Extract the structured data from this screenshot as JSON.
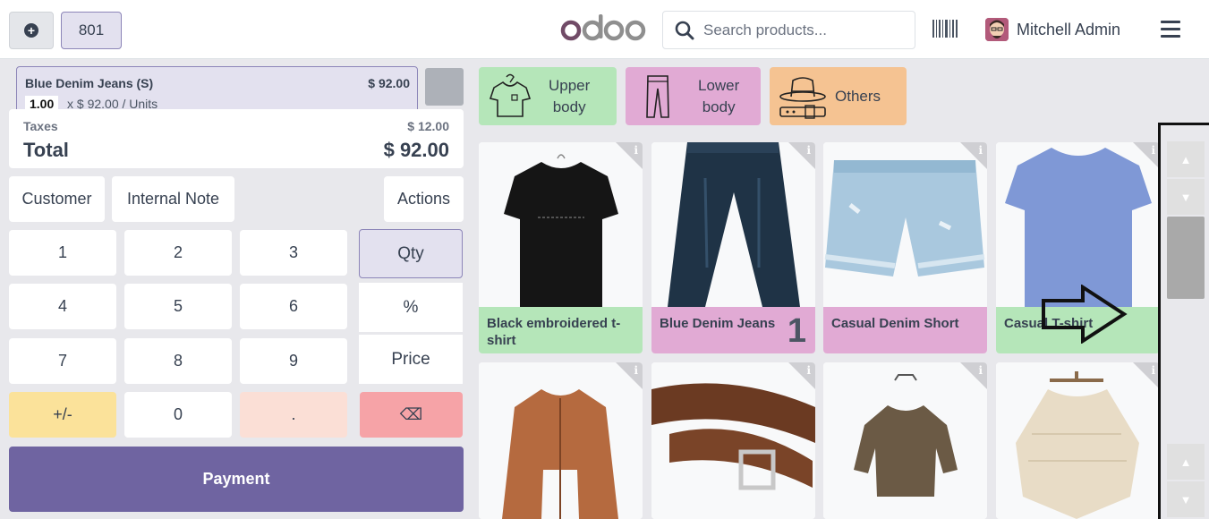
{
  "topbar": {
    "order_number": "801",
    "logo_text": "odoo",
    "search_placeholder": "Search products...",
    "user_name": "Mitchell Admin"
  },
  "order": {
    "line_name": "Blue Denim Jeans (S)",
    "line_price": "$ 92.00",
    "line_qty": "1.00",
    "line_unit": "x $ 92.00 / Units",
    "taxes_label": "Taxes",
    "taxes_value": "$ 12.00",
    "total_label": "Total",
    "total_value": "$ 92.00"
  },
  "control_buttons": {
    "customer": "Customer",
    "internal_note": "Internal Note",
    "actions": "Actions"
  },
  "numpad": {
    "keys": [
      "1",
      "2",
      "3",
      "4",
      "5",
      "6",
      "7",
      "8",
      "9",
      "+/-",
      "0",
      "."
    ],
    "backspace": "⌫",
    "modes": [
      "Qty",
      "%",
      "Price"
    ],
    "active_mode": "Qty"
  },
  "payment_label": "Payment",
  "categories": [
    {
      "line1": "Upper",
      "line2": "body",
      "color": "#b5e6b9",
      "icon": "shirt-icon"
    },
    {
      "line1": "Lower",
      "line2": "body",
      "color": "#e1aad4",
      "icon": "pants-icon"
    },
    {
      "line1": "Others",
      "line2": "",
      "color": "#f5c392",
      "icon": "hat-belt-icon"
    }
  ],
  "products": [
    {
      "name": "Black embroidered t-shirt",
      "color": "#b5e6b9",
      "badge": ""
    },
    {
      "name": "Blue Denim Jeans",
      "color": "#e1aad4",
      "badge": "1"
    },
    {
      "name": "Casual Denim Short",
      "color": "#e1aad4",
      "badge": ""
    },
    {
      "name": "Casual T-shirt",
      "color": "#b5e6b9",
      "badge": ""
    },
    {
      "name": "",
      "color": "",
      "badge": ""
    },
    {
      "name": "",
      "color": "",
      "badge": ""
    },
    {
      "name": "",
      "color": "",
      "badge": ""
    },
    {
      "name": "",
      "color": "",
      "badge": ""
    }
  ],
  "colors": {
    "accent": "#6f64a1",
    "plus_minus": "#fbe29a",
    "dot": "#fbdfd6",
    "backspace": "#f6a3a7"
  }
}
